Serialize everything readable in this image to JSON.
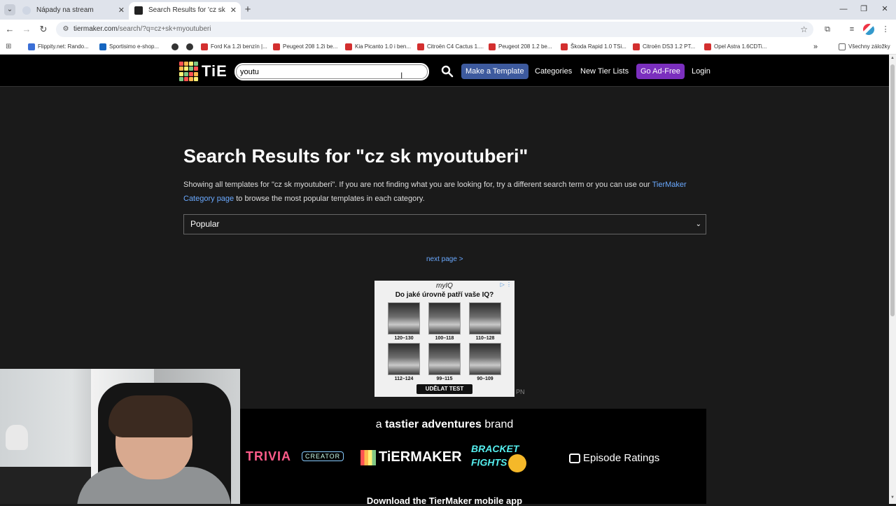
{
  "browser": {
    "tabs": [
      {
        "title": "Nápady na stream",
        "active": false
      },
      {
        "title": "Search Results for 'cz sk myoutuberi'",
        "active": true
      }
    ],
    "url_host": "tiermaker.com",
    "url_rest": "/search/?q=cz+sk+myoutuberi",
    "bookmarks": [
      {
        "label": "Flippity.net: Rando...",
        "color": "#3b6fd6"
      },
      {
        "label": "Sportisimo e-shop...",
        "color": "#1565c0"
      },
      {
        "label": "",
        "color": "#333333"
      },
      {
        "label": "",
        "color": "#333333"
      },
      {
        "label": "Ford Ka 1.2i benzín |...",
        "color": "#d32f2f"
      },
      {
        "label": "Peugeot 208 1.2i be...",
        "color": "#d32f2f"
      },
      {
        "label": "Kia Picanto 1.0 i ben...",
        "color": "#d32f2f"
      },
      {
        "label": "Citroën C4 Cactus 1....",
        "color": "#d32f2f"
      },
      {
        "label": "Peugeot 208 1.2 be...",
        "color": "#d32f2f"
      },
      {
        "label": "Škoda Rapid 1.0 TSi...",
        "color": "#d32f2f"
      },
      {
        "label": "Citroën DS3 1.2 PT...",
        "color": "#d32f2f"
      },
      {
        "label": "Opel Astra 1.6CDTi...",
        "color": "#d32f2f"
      }
    ],
    "bookmarks_overflow": "»",
    "all_bookmarks": "Všechny záložky"
  },
  "header": {
    "logo_text": "TiE",
    "search_value": "youtu",
    "make_template": "Make a Template",
    "categories": "Categories",
    "new_tier_lists": "New Tier Lists",
    "go_ad_free": "Go Ad-Free",
    "login": "Login",
    "accent_blue": "#3d5a9e",
    "accent_purple": "#7b2fbe"
  },
  "main": {
    "title": "Search Results for \"cz sk myoutuberi\"",
    "intro_before": "Showing all templates for \"cz sk myoutuberi\". If you are not finding what you are looking for, try a different search term or you can use our ",
    "intro_link": "TierMaker Category page",
    "intro_after": " to browse the most popular templates in each category.",
    "sort_selected": "Popular",
    "next_page": "next page >"
  },
  "ad": {
    "brand": "myIQ",
    "question": "Do jaké úrovně patří vaše IQ?",
    "ranges": [
      "120–130",
      "100–118",
      "110–128",
      "112–124",
      "99–115",
      "90–109"
    ],
    "cta": "UDĚLAT TEST",
    "marker": "PN"
  },
  "footer": {
    "brand_prefix": "a ",
    "brand_name": "tastier adventures",
    "brand_suffix": " brand",
    "trivia": "TRIVIA",
    "creator": "CREATOR",
    "tiermaker": "TiERMAKER",
    "bracket": "BRACKET",
    "fights": "FIGHTS",
    "episodes": "Episode Ratings",
    "download": "Download the TierMaker mobile app"
  }
}
